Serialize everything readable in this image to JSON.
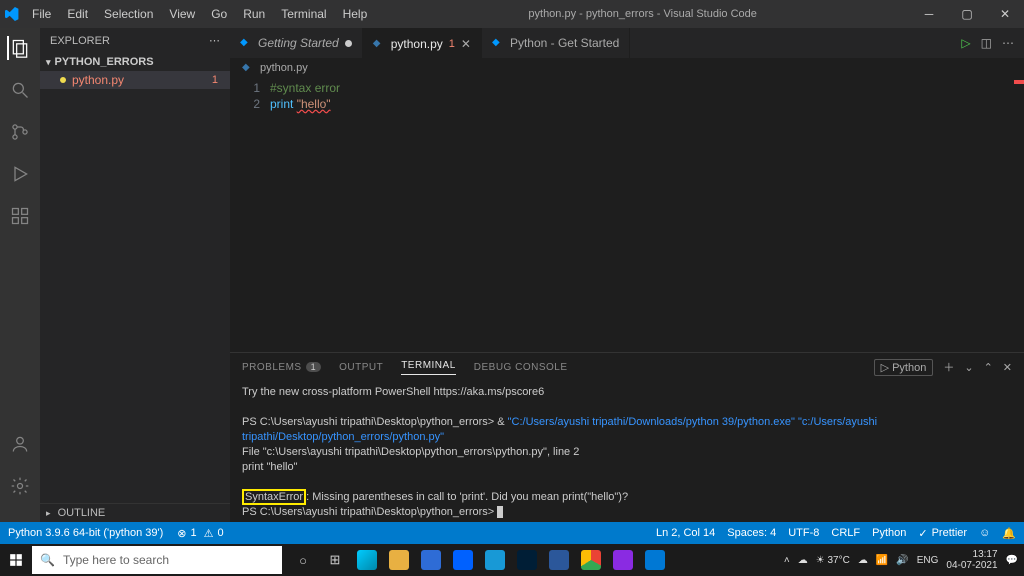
{
  "title": "python.py - python_errors - Visual Studio Code",
  "menu": [
    "File",
    "Edit",
    "Selection",
    "View",
    "Go",
    "Run",
    "Terminal",
    "Help"
  ],
  "sidebar": {
    "header": "EXPLORER",
    "folder": "PYTHON_ERRORS",
    "file": {
      "name": "python.py",
      "errors": "1"
    },
    "outline": "OUTLINE"
  },
  "tabs": [
    {
      "label": "Getting Started",
      "kind": "vs",
      "active": false,
      "modified": true,
      "badge": ""
    },
    {
      "label": "python.py",
      "kind": "py",
      "active": true,
      "modified": false,
      "badge": "1"
    },
    {
      "label": "Python - Get Started",
      "kind": "vs",
      "active": false,
      "modified": false,
      "badge": ""
    }
  ],
  "breadcrumb": "python.py",
  "editor": {
    "lines": [
      {
        "num": "1",
        "segments": [
          {
            "t": "#syntax error",
            "c": "c-comment"
          }
        ]
      },
      {
        "num": "2",
        "segments": [
          {
            "t": "print ",
            "c": "c-kw"
          },
          {
            "t": "\"hello\"",
            "c": "c-str"
          }
        ]
      }
    ]
  },
  "panel": {
    "tabs": {
      "problems": "PROBLEMS",
      "problemsCount": "1",
      "output": "OUTPUT",
      "terminal": "TERMINAL",
      "debug": "DEBUG CONSOLE"
    },
    "shell": "Python",
    "term": {
      "l1": "Try the new cross-platform PowerShell https://aka.ms/pscore6",
      "l2a": "PS C:\\Users\\ayushi tripathi\\Desktop\\python_errors> & ",
      "l2b": "\"C:/Users/ayushi tripathi/Downloads/python 39/python.exe\" \"c:/Users/ayushi tripathi/Desktop/python_errors/python.py\"",
      "l3": "  File \"c:\\Users\\ayushi tripathi\\Desktop\\python_errors\\python.py\", line 2",
      "l4": "    print \"hello\"",
      "l5a": "SyntaxError",
      "l5b": ": Missing parentheses in call to 'print'. Did you mean print(\"hello\")?",
      "l6": "PS C:\\Users\\ayushi tripathi\\Desktop\\python_errors> "
    }
  },
  "status": {
    "py": "Python 3.9.6 64-bit ('python 39')",
    "err": "1",
    "warn": "0",
    "ln": "Ln 2, Col 14",
    "spaces": "Spaces: 4",
    "enc": "UTF-8",
    "eol": "CRLF",
    "lang": "Python",
    "fmt": "Prettier"
  },
  "taskbar": {
    "searchPlaceholder": "Type here to search",
    "weather": "37°C",
    "lang": "ENG",
    "time": "13:17",
    "date": "04-07-2021"
  }
}
